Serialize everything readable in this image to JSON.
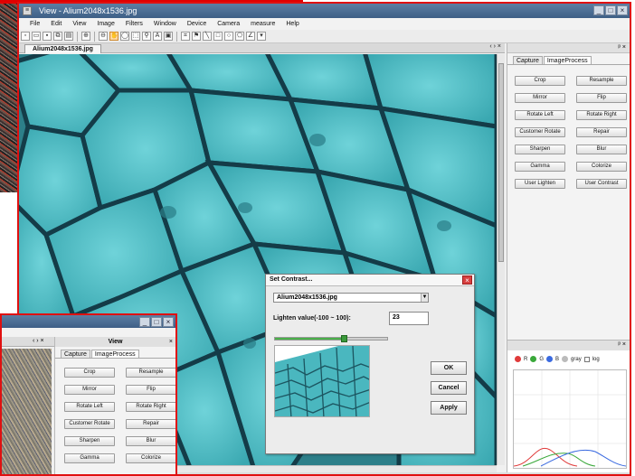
{
  "main_window": {
    "title": "View - Alium2048x1536.jpg",
    "app_icon": "≡",
    "window_buttons": [
      "_",
      "□",
      "×"
    ],
    "menu": [
      "File",
      "Edit",
      "View",
      "Image",
      "Filters",
      "Window",
      "Device",
      "Camera",
      "measure",
      "Help"
    ]
  },
  "toolbar_icons": [
    "new-file-icon",
    "open-folder-icon",
    "save-icon",
    "copy-icon",
    "paste-icon",
    "zoom-in-icon",
    "zoom-out-icon",
    "hand-tool-icon",
    "ellipse-icon",
    "rectangle-select-icon",
    "magnifier-icon",
    "text-tool-icon",
    "image-icon",
    "crop-icon",
    "pin-icon",
    "line-icon",
    "rectangle-icon",
    "circle-icon",
    "polygon-icon",
    "angle-icon",
    "dropdown-icon"
  ],
  "document": {
    "tab_label": "Alium2048x1536.jpg",
    "tab_controls": "‹ › ×"
  },
  "right_panel": {
    "header_controls": "ᵖ ×",
    "tabs": [
      "Capture",
      "ImageProcess"
    ],
    "selected_tab": "ImageProcess",
    "buttons": [
      "Crop",
      "Resample",
      "Mirror",
      "Flip",
      "Rotate Left",
      "Rotate Right",
      "Customer Rotate",
      "Repair",
      "Sharpen",
      "Blur",
      "Gamma",
      "Colorize",
      "User Lighten",
      "User Contrast"
    ]
  },
  "histogram_panel": {
    "header_controls": "ᵖ ×",
    "channels": [
      {
        "label": "R",
        "color": "#e03a3a"
      },
      {
        "label": "G",
        "color": "#3aa83a"
      },
      {
        "label": "B",
        "color": "#3a6ae0"
      }
    ],
    "gray_label": "gray",
    "log_label": "log"
  },
  "dialog": {
    "title": "Set Contrast...",
    "close": "×",
    "image_select": "Alium2048x1536.jpg",
    "lighten_label": "Lighten value(-100 ~ 100):",
    "lighten_value": "23",
    "slider_fraction": 0.61,
    "ok": "OK",
    "cancel": "Cancel",
    "apply": "Apply"
  },
  "secondary_window": {
    "panel_title": "View",
    "panel_close": "×",
    "tab_controls": "‹ › ×",
    "tabs": [
      "Capture",
      "ImageProcess"
    ],
    "buttons": [
      "Crop",
      "Resample",
      "Mirror",
      "Flip",
      "Rotate Left",
      "Rotate Right",
      "Customer Rotate",
      "Repair",
      "Sharpen",
      "Blur",
      "Gamma",
      "Colorize"
    ]
  }
}
